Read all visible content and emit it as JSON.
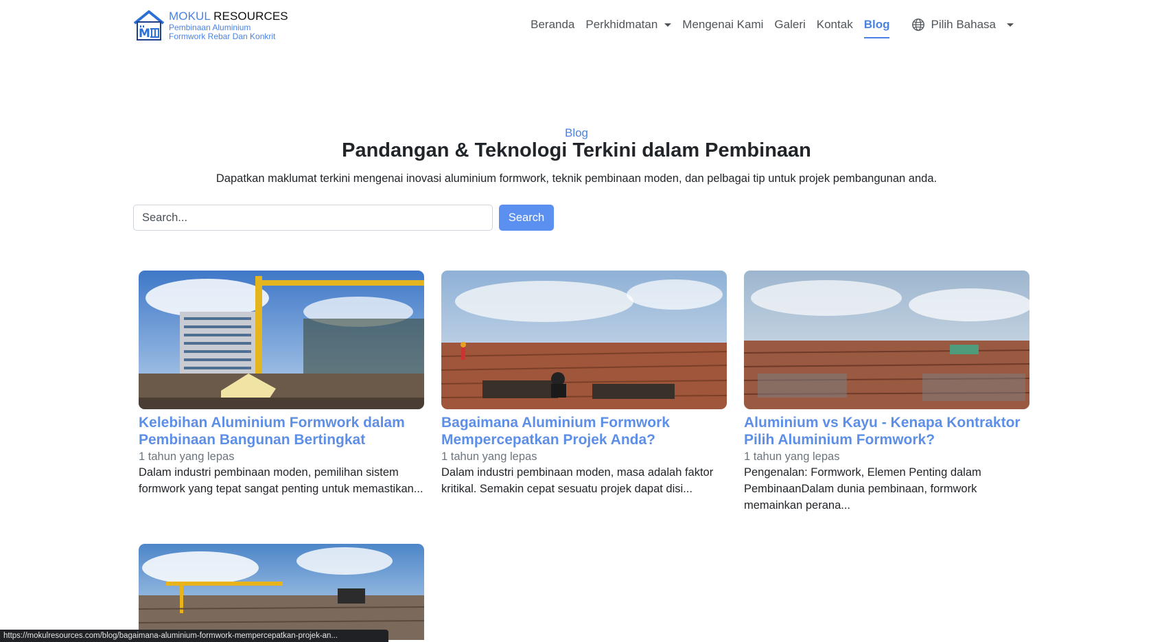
{
  "brand": {
    "name_part1": "MOKUL",
    "name_part2": "RESOURCES",
    "tagline_line1": "Pembinaan Aluminium",
    "tagline_line2": "Formwork Rebar Dan Konkrit"
  },
  "nav": {
    "items": [
      {
        "label": "Beranda"
      },
      {
        "label": "Perkhidmatan"
      },
      {
        "label": "Mengenai Kami"
      },
      {
        "label": "Galeri"
      },
      {
        "label": "Kontak"
      },
      {
        "label": "Blog"
      }
    ],
    "language": "Pilih Bahasa"
  },
  "hero": {
    "kicker": "Blog",
    "title": "Pandangan & Teknologi Terkini dalam Pembinaan",
    "description": "Dapatkan maklumat terkini mengenai inovasi aluminium formwork, teknik pembinaan moden, dan pelbagai tip untuk projek pembangunan anda."
  },
  "search": {
    "placeholder": "Search...",
    "button_label": "Search"
  },
  "posts": [
    {
      "title": "Kelebihan Aluminium Formwork dalam Pembinaan Bangunan Bertingkat",
      "date": "1 tahun yang lepas",
      "excerpt": "Dalam industri pembinaan moden, pemilihan sistem formwork yang tepat sangat penting untuk memastikan..."
    },
    {
      "title": "Bagaimana Aluminium Formwork Mempercepatkan Projek Anda?",
      "date": "1 tahun yang lepas",
      "excerpt": "Dalam industri pembinaan moden, masa adalah faktor kritikal. Semakin cepat sesuatu projek dapat disi..."
    },
    {
      "title": "Aluminium vs Kayu - Kenapa Kontraktor Pilih Aluminium Formwork?",
      "date": "1 tahun yang lepas",
      "excerpt": "Pengenalan: Formwork, Elemen Penting dalam PembinaanDalam dunia pembinaan, formwork memainkan perana..."
    }
  ],
  "status_url": "https://mokulresources.com/blog/bagaimana-aluminium-formwork-mempercepatkan-projek-an...",
  "colors": {
    "accent": "#4a82e4",
    "button": "#5b8ff0"
  }
}
